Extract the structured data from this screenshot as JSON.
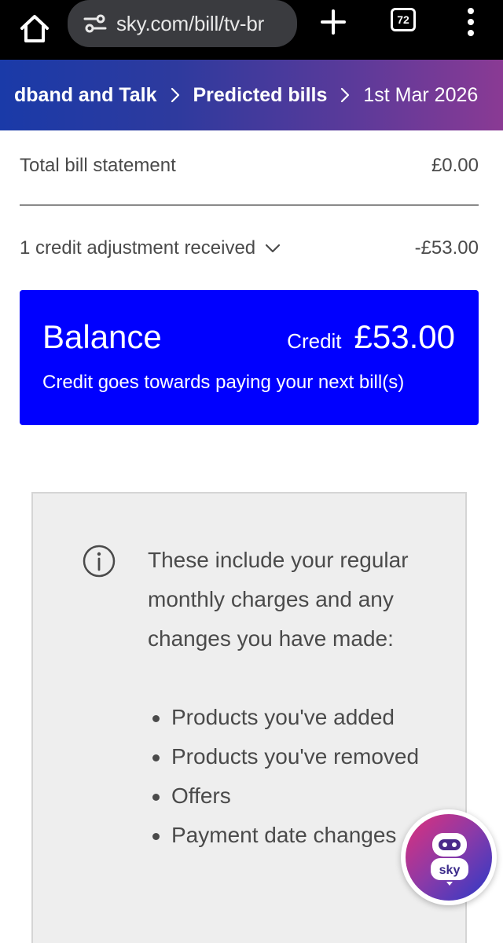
{
  "browser": {
    "url": "sky.com/bill/tv-br",
    "tab_count": "72"
  },
  "breadcrumb": {
    "items": [
      {
        "label": "dband and Talk"
      },
      {
        "label": "Predicted bills"
      },
      {
        "label": "1st Mar 2026"
      }
    ]
  },
  "summary": {
    "total_label": "Total bill statement",
    "total_value": "£0.00",
    "credit_label": "1 credit adjustment received",
    "credit_value": "-£53.00"
  },
  "balance": {
    "title": "Balance",
    "type": "Credit",
    "amount": "£53.00",
    "note": "Credit goes towards paying your next bill(s)"
  },
  "info": {
    "intro": "These include your regular monthly charges and any changes you have made:",
    "items": [
      "Products you've added",
      "Products you've removed",
      "Offers",
      "Payment date changes"
    ]
  },
  "chat": {
    "logo": "sky"
  },
  "colors": {
    "balance_bg": "#0000ff",
    "banner_start": "#1a3aa8",
    "banner_end": "#8a3a94"
  },
  "icons": [
    "home-icon",
    "site-settings-icon",
    "plus-icon",
    "tab-switcher-icon",
    "more-vert-icon",
    "chevron-right-icon",
    "chevron-down-icon",
    "info-icon",
    "chat-robot-icon"
  ]
}
